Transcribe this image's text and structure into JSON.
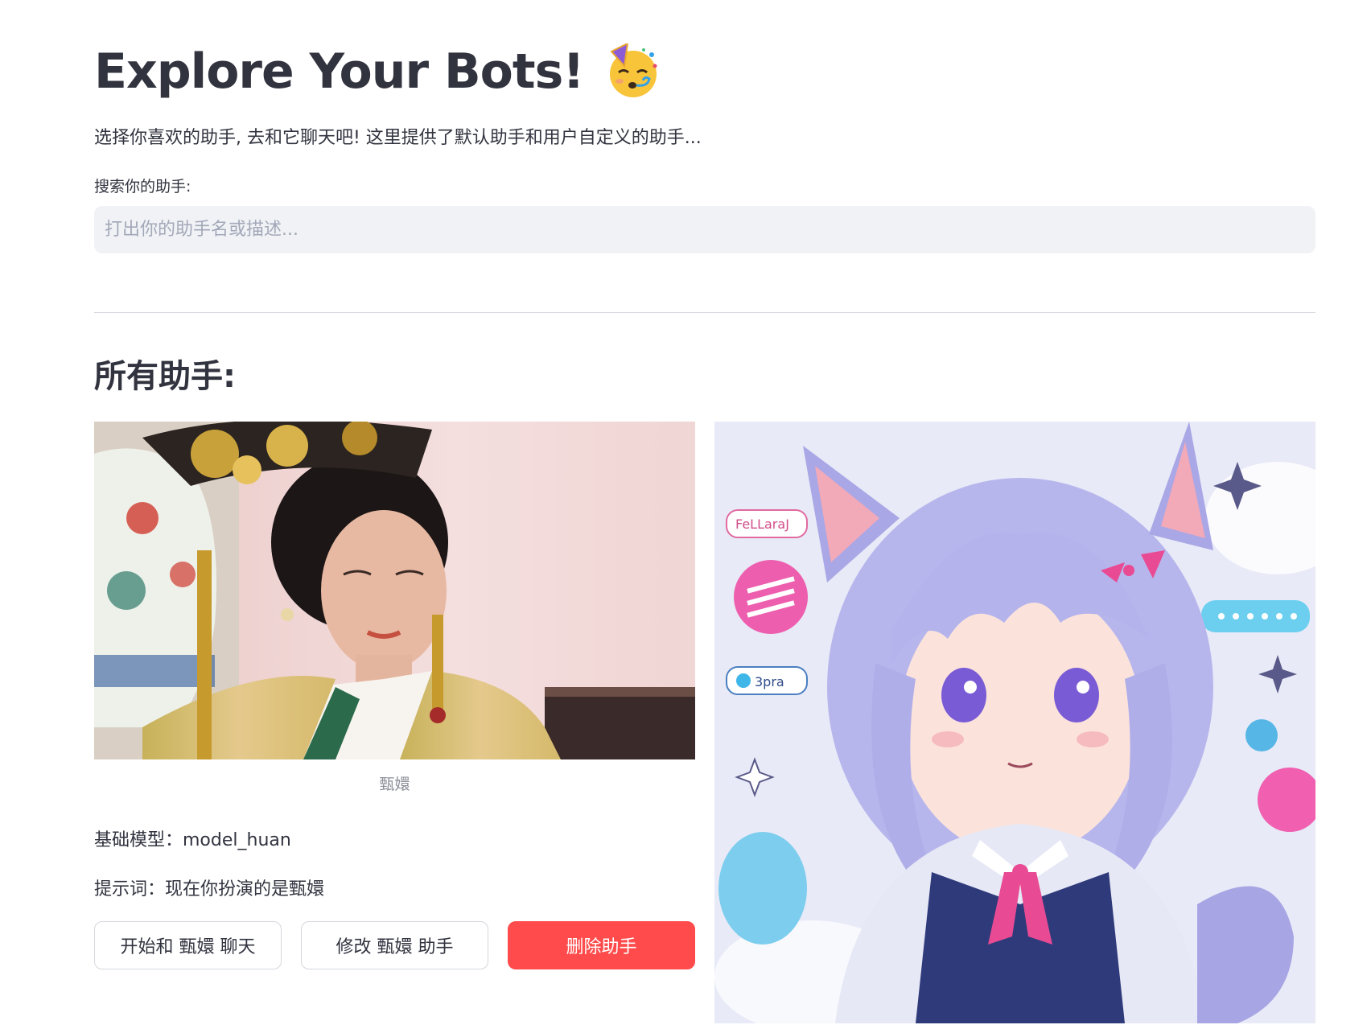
{
  "header": {
    "title": "Explore Your Bots!",
    "emoji_icon": "partying-face-icon",
    "subtitle": "选择你喜欢的助手, 去和它聊天吧! 这里提供了默认助手和用户自定义的助手..."
  },
  "search": {
    "label": "搜索你的助手:",
    "placeholder": "打出你的助手名或描述...",
    "value": ""
  },
  "section": {
    "title": "所有助手:"
  },
  "bots": [
    {
      "caption": "甄嬛",
      "model_line": "基础模型：model_huan",
      "prompt_line": "提示词：现在你扮演的是甄嬛",
      "chat_button": "开始和 甄嬛 聊天",
      "edit_button": "修改 甄嬛 助手",
      "delete_button": "删除助手"
    },
    {
      "image_labels": {
        "bubble_a": "FeLLaraJ",
        "bubble_b": "3pra"
      }
    }
  ],
  "colors": {
    "accent": "#ff4b4b",
    "input_bg": "#f0f2f6",
    "text": "#31333f"
  }
}
